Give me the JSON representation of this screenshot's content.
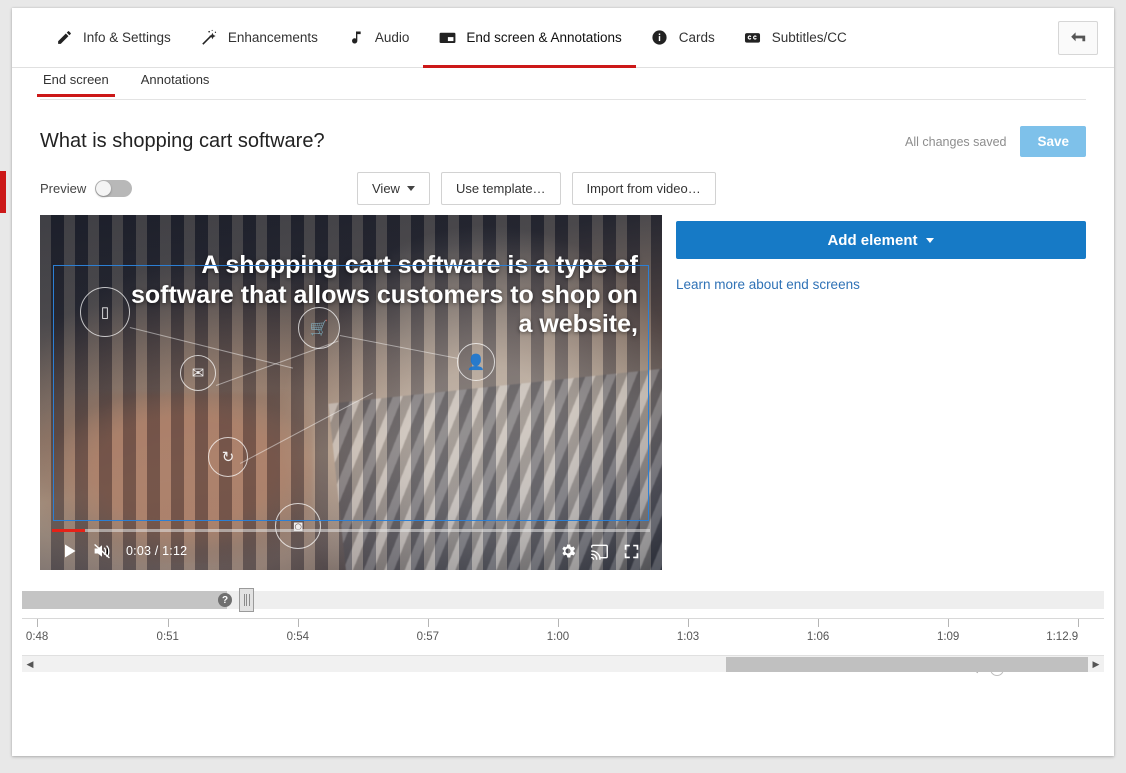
{
  "nav": {
    "tabs": [
      {
        "label": "Info & Settings",
        "icon": "pencil-icon",
        "active": false
      },
      {
        "label": "Enhancements",
        "icon": "magic-wand-icon",
        "active": false
      },
      {
        "label": "Audio",
        "icon": "music-note-icon",
        "active": false
      },
      {
        "label": "End screen & Annotations",
        "icon": "end-screen-icon",
        "active": true
      },
      {
        "label": "Cards",
        "icon": "info-circle-icon",
        "active": false
      },
      {
        "label": "Subtitles/CC",
        "icon": "closed-caption-icon",
        "active": false
      }
    ],
    "back_button_icon": "back-arrow-icon",
    "active_underline_color": "#cc1818"
  },
  "subtabs": [
    {
      "label": "End screen",
      "active": true
    },
    {
      "label": "Annotations",
      "active": false
    }
  ],
  "title": {
    "video_title": "What is shopping cart software?",
    "saved_status": "All changes saved",
    "save_label": "Save",
    "save_color": "#7ec1ea"
  },
  "toolbar": {
    "preview_label": "Preview",
    "preview_on": false,
    "view_label": "View",
    "use_template_label": "Use template…",
    "import_label": "Import from video…"
  },
  "player": {
    "overlay_text": "A shopping cart software is a type of software that allows customers to shop on a website,",
    "current_time": "0:03",
    "duration": "1:12",
    "time_display": "0:03 / 1:12",
    "play_icon": "play-icon",
    "volume_icon": "volume-muted-icon",
    "settings_icon": "gear-icon",
    "cast_icon": "cast-icon",
    "fullscreen_icon": "fullscreen-icon",
    "progress_percent": 4,
    "progress_color": "#e62117",
    "safe_area_color": "#2c7fd4"
  },
  "right_panel": {
    "add_element_label": "Add element",
    "add_element_color": "#167ac6",
    "learn_more_label": "Learn more about end screens",
    "link_color": "#2f72b6"
  },
  "timeline": {
    "help_icon": "help-circle-icon",
    "help_glyph": "?",
    "handle_icon": "drag-handle-icon",
    "zoom_icon": "magnifier-icon",
    "zoom_value": 0,
    "ticks": [
      {
        "label": "0:48",
        "pos": 2.7
      },
      {
        "label": "0:51",
        "pos": 26.0
      },
      {
        "label": "0:54",
        "pos": 49.2
      },
      {
        "label": "0:57",
        "pos": 72.4
      },
      {
        "label": "1:00",
        "pos": 95.6
      },
      {
        "label": "1:03",
        "pos": 118.8
      },
      {
        "label": "1:06",
        "pos": 142.0
      },
      {
        "label": "1:09",
        "pos": 165.2
      },
      {
        "label": "1:12.9",
        "pos": 188.4
      }
    ],
    "scroll_left_arrow": "scroll-left-arrow-icon",
    "scroll_right_arrow": "scroll-right-arrow-icon"
  }
}
